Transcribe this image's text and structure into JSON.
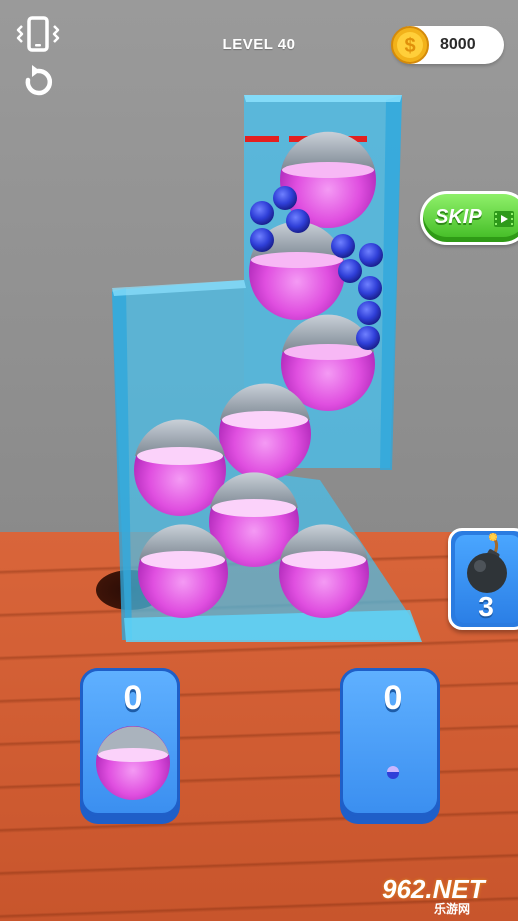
{
  "hud": {
    "level_label": "LEVEL 40",
    "coins": "8000",
    "skip_label": "SKIP",
    "bomb_count": "3"
  },
  "cups": {
    "left_count": "0",
    "right_count": "0"
  },
  "watermark": {
    "main": "962.NET",
    "sub": "乐游网"
  },
  "icons": {
    "vibration": "phone-vibrate-icon",
    "undo": "restart-icon",
    "coin": "dollar-coin-icon",
    "skip_video": "video-icon",
    "bomb": "bomb-icon"
  },
  "colors": {
    "ball_pink": "#e04fe0",
    "ball_blue": "#2f3fd8",
    "glass": "#4cc8f5",
    "floor": "#d9653a",
    "skip_green": "#4ccf2a",
    "cup_blue": "#3b8ff0"
  }
}
